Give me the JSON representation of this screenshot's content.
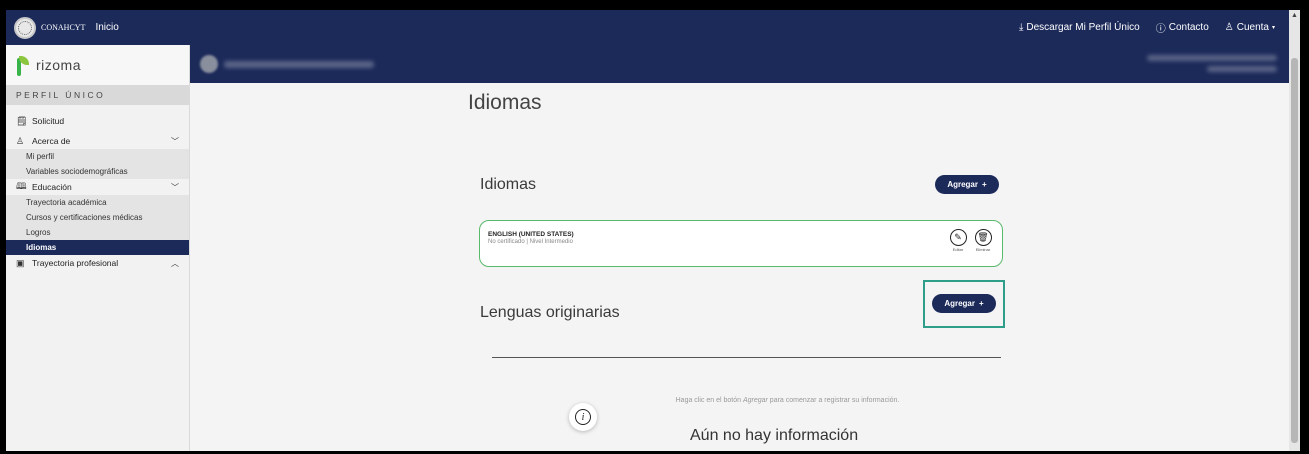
{
  "topbar": {
    "brand": "CONAHCYT",
    "inicio": "Inicio",
    "download": "Descargar Mi Perfil Único",
    "contact": "Contacto",
    "account": "Cuenta",
    "download_icon": "download-icon",
    "contact_icon": "help-circle-icon",
    "account_icon": "user-icon"
  },
  "sidebar": {
    "logo": "rizoma",
    "section_header": "PERFIL ÚNICO",
    "items": [
      {
        "label": "Solicitud",
        "icon": "document-icon"
      },
      {
        "label": "Acerca de",
        "icon": "user-icon",
        "expanded": true,
        "children": [
          "Mi perfil",
          "Variables sociodemográficas"
        ]
      },
      {
        "label": "Educación",
        "icon": "book-icon",
        "expanded": true,
        "children": [
          "Trayectoria académica",
          "Cursos y certificaciones médicas",
          "Logros",
          "Idiomas"
        ]
      },
      {
        "label": "Trayectoria profesional",
        "icon": "briefcase-icon",
        "expanded": false
      }
    ],
    "active": "Idiomas"
  },
  "main": {
    "page_title": "Idiomas",
    "idiomas_section": "Idiomas",
    "agregar_label": "Agregar",
    "language_card": {
      "title": "ENGLISH (UNITED STATES)",
      "subtitle": "No certificado | Nivel Intermedio",
      "edit_label": "Editar",
      "delete_label": "Eliminar"
    },
    "lenguas_section": "Lenguas originarias",
    "empty_pre": "Haga clic en el botón ",
    "empty_em": "Agregar",
    "empty_post": " para comenzar a registrar su información.",
    "empty_title": "Aún no hay información"
  },
  "colors": {
    "navy": "#1c2a5a",
    "card_border": "#59b96b",
    "highlight": "#2f9e88"
  }
}
